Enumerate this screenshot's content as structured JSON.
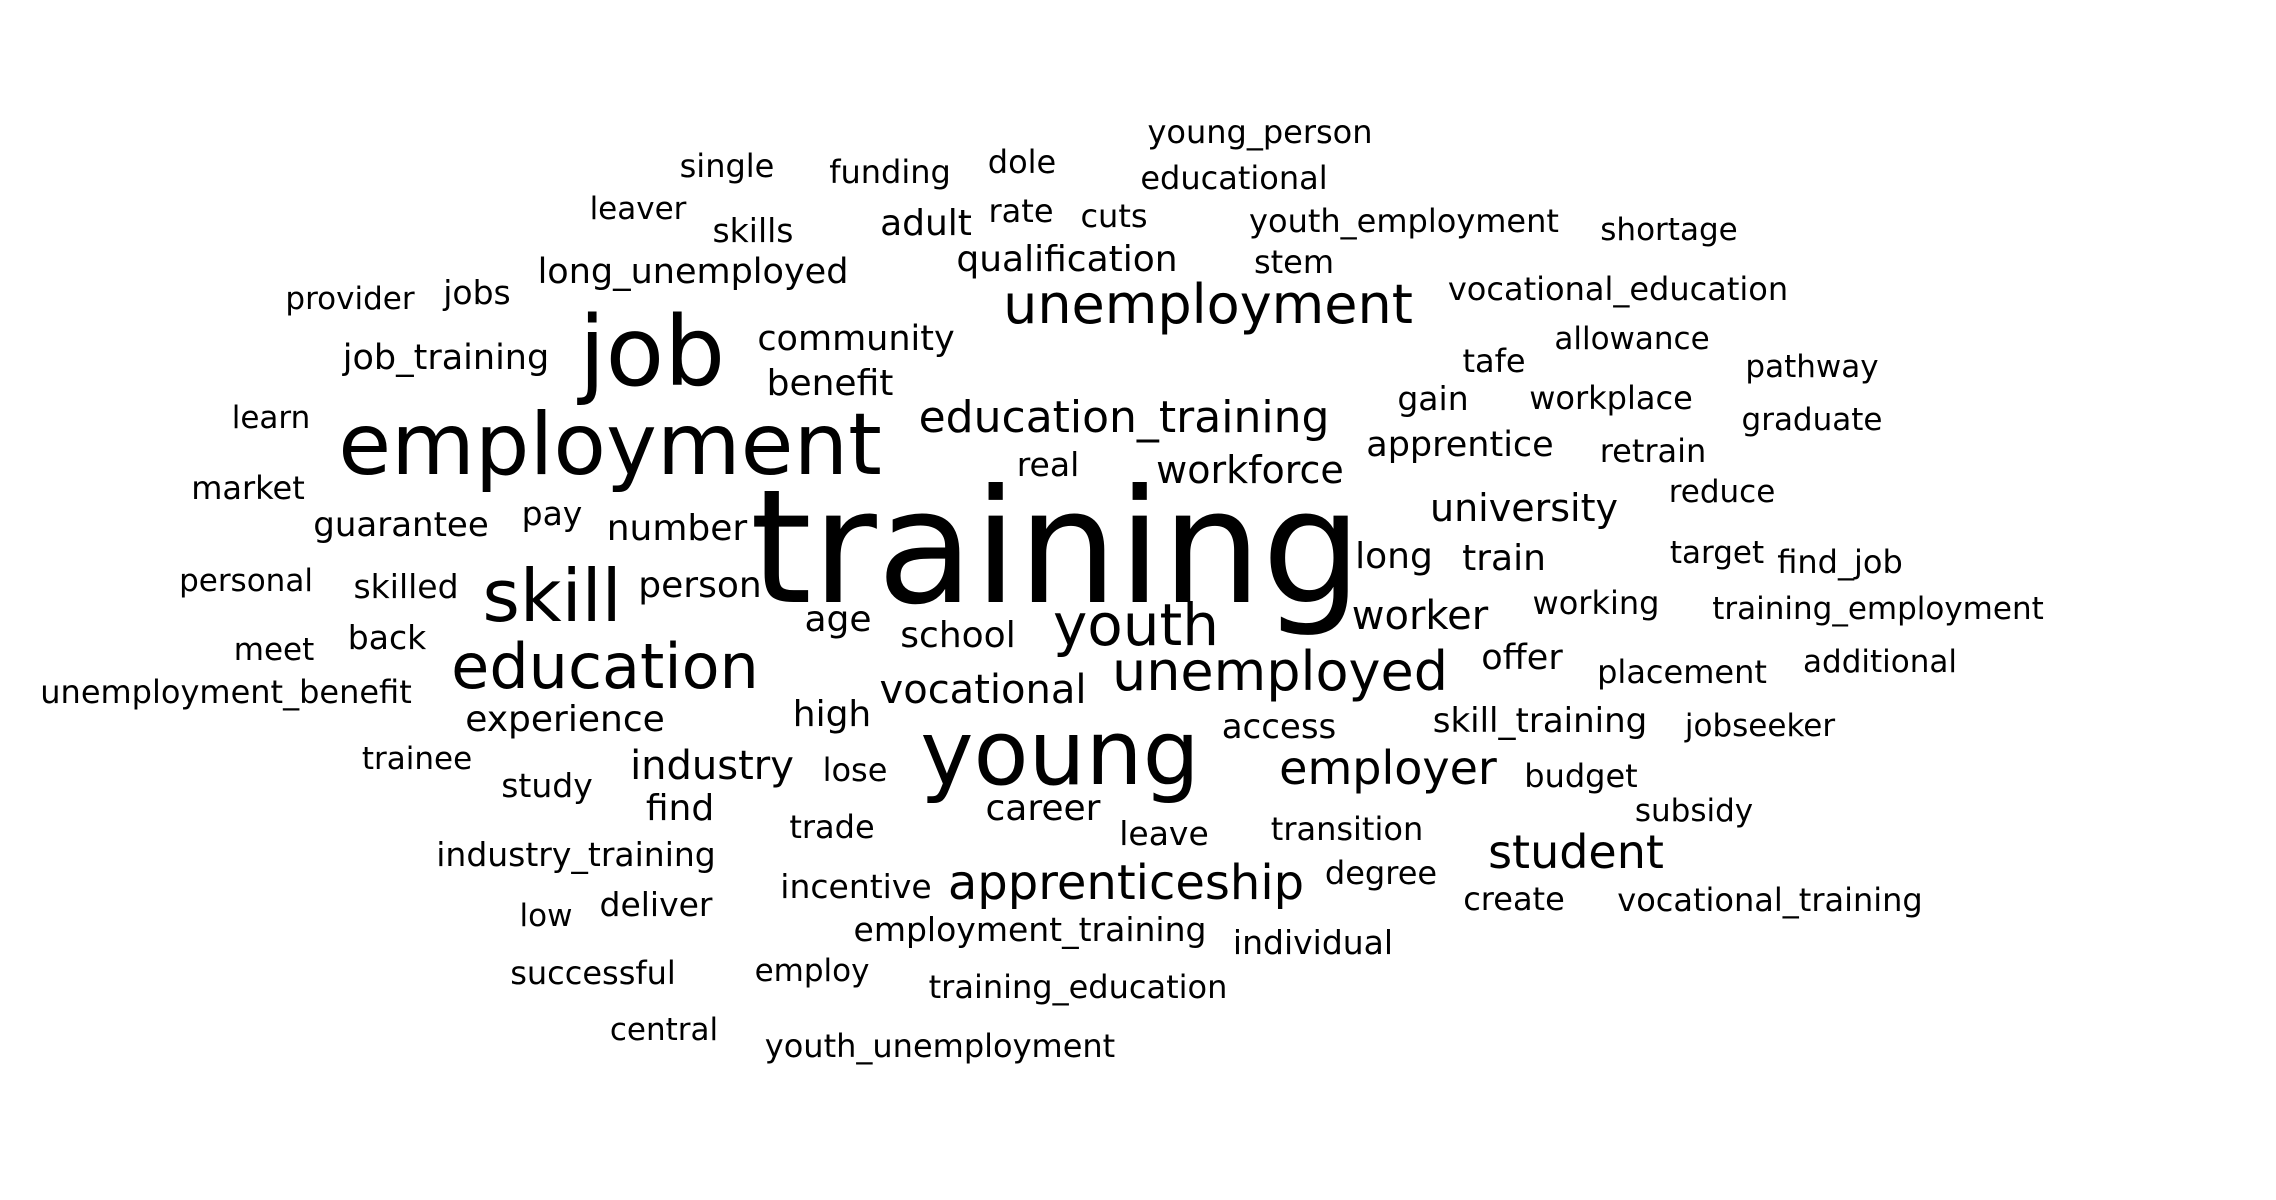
{
  "text_color": "#000000",
  "background_color": "#ffffff",
  "words": [
    {
      "text": "training"
    },
    {
      "text": "employment"
    },
    {
      "text": "job"
    },
    {
      "text": "young"
    },
    {
      "text": "skill"
    },
    {
      "text": "education"
    },
    {
      "text": "unemployment"
    },
    {
      "text": "unemployed"
    },
    {
      "text": "youth"
    },
    {
      "text": "education_training"
    },
    {
      "text": "apprenticeship"
    },
    {
      "text": "employer"
    },
    {
      "text": "student"
    },
    {
      "text": "vocational"
    },
    {
      "text": "workforce"
    },
    {
      "text": "university"
    },
    {
      "text": "worker"
    },
    {
      "text": "industry"
    },
    {
      "text": "experience"
    },
    {
      "text": "long"
    },
    {
      "text": "train"
    },
    {
      "text": "community"
    },
    {
      "text": "benefit"
    },
    {
      "text": "job_training"
    },
    {
      "text": "long_unemployed"
    },
    {
      "text": "qualification"
    },
    {
      "text": "apprentice"
    },
    {
      "text": "career"
    },
    {
      "text": "number"
    },
    {
      "text": "person"
    },
    {
      "text": "school"
    },
    {
      "text": "age"
    },
    {
      "text": "offer"
    },
    {
      "text": "high"
    },
    {
      "text": "find"
    },
    {
      "text": "access"
    },
    {
      "text": "skill_training"
    },
    {
      "text": "employment_training"
    },
    {
      "text": "youth_employment"
    },
    {
      "text": "vocational_education"
    },
    {
      "text": "industry_training"
    },
    {
      "text": "guarantee"
    },
    {
      "text": "young_person"
    },
    {
      "text": "educational"
    },
    {
      "text": "funding"
    },
    {
      "text": "adult"
    },
    {
      "text": "stem"
    },
    {
      "text": "cuts"
    },
    {
      "text": "dole"
    },
    {
      "text": "rate"
    },
    {
      "text": "single"
    },
    {
      "text": "skills"
    },
    {
      "text": "leaver"
    },
    {
      "text": "shortage"
    },
    {
      "text": "provider"
    },
    {
      "text": "jobs"
    },
    {
      "text": "tafe"
    },
    {
      "text": "allowance"
    },
    {
      "text": "pathway"
    },
    {
      "text": "gain"
    },
    {
      "text": "workplace"
    },
    {
      "text": "graduate"
    },
    {
      "text": "retrain"
    },
    {
      "text": "learn"
    },
    {
      "text": "real"
    },
    {
      "text": "market"
    },
    {
      "text": "reduce"
    },
    {
      "text": "pay"
    },
    {
      "text": "target"
    },
    {
      "text": "find_job"
    },
    {
      "text": "personal"
    },
    {
      "text": "skilled"
    },
    {
      "text": "working"
    },
    {
      "text": "training_employment"
    },
    {
      "text": "meet"
    },
    {
      "text": "back"
    },
    {
      "text": "placement"
    },
    {
      "text": "additional"
    },
    {
      "text": "unemployment_benefit"
    },
    {
      "text": "jobseeker"
    },
    {
      "text": "trainee"
    },
    {
      "text": "study"
    },
    {
      "text": "lose"
    },
    {
      "text": "budget"
    },
    {
      "text": "subsidy"
    },
    {
      "text": "trade"
    },
    {
      "text": "leave"
    },
    {
      "text": "transition"
    },
    {
      "text": "degree"
    },
    {
      "text": "incentive"
    },
    {
      "text": "create"
    },
    {
      "text": "vocational_training"
    },
    {
      "text": "deliver"
    },
    {
      "text": "low"
    },
    {
      "text": "individual"
    },
    {
      "text": "successful"
    },
    {
      "text": "employ"
    },
    {
      "text": "training_education"
    },
    {
      "text": "central"
    },
    {
      "text": "youth_unemployment"
    }
  ]
}
